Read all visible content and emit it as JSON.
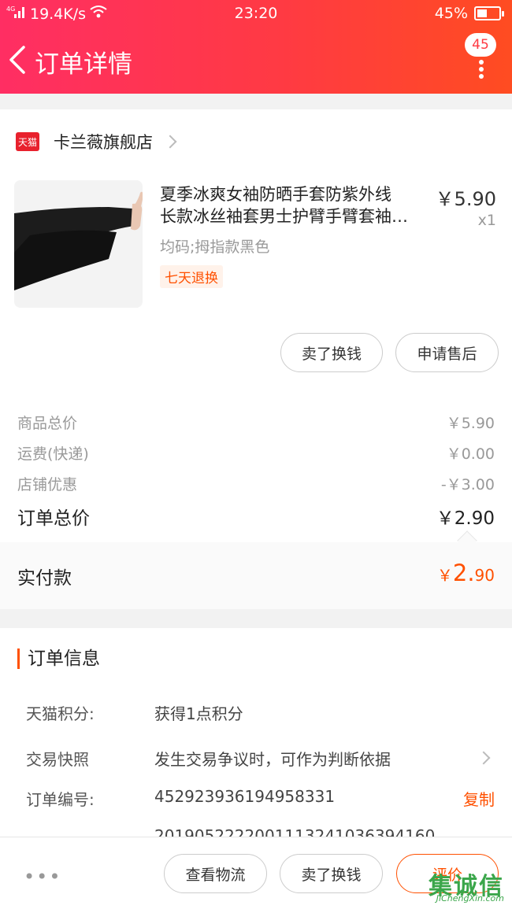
{
  "status_bar": {
    "network": "4G",
    "speed": "19.4K/s",
    "time": "23:20",
    "battery": "45%",
    "battery_level": 0.45
  },
  "header": {
    "title": "订单详情",
    "badge_count": "45",
    "gradient": [
      "#ff2e63",
      "#ff4c21"
    ]
  },
  "store": {
    "logo_text": "天猫",
    "name": "卡兰薇旗舰店"
  },
  "product": {
    "title_line1": "夏季冰爽女袖防晒手套防紫外线",
    "title_line2": "长款冰丝袖套男士护臂手臂套袖…",
    "price": "￥5.90",
    "quantity": "x1",
    "sku": "均码;拇指款黑色",
    "tag": "七天退换",
    "actions": [
      "卖了换钱",
      "申请售后"
    ]
  },
  "summary": {
    "rows": [
      {
        "label": "商品总价",
        "value": "￥5.90"
      },
      {
        "label": "运费(快递)",
        "value": "￥0.00"
      },
      {
        "label": "店铺优惠",
        "value": "-￥3.00"
      }
    ],
    "total_label": "订单总价",
    "total_value": "￥2.90",
    "paid_label": "实付款",
    "paid_currency": "￥",
    "paid_int": "2.",
    "paid_dec": "90"
  },
  "order_info": {
    "title": "订单信息",
    "rows": [
      {
        "label": "天猫积分:",
        "value": "获得1点积分"
      },
      {
        "label": "交易快照",
        "value": "发生交易争议时，可作为判断依据"
      },
      {
        "label": "订单编号:",
        "value": "452923936194958331",
        "action": "复制"
      }
    ],
    "partial_value": "2019052222001113241036394160"
  },
  "bottom_bar": {
    "more": "•••",
    "buttons": [
      "查看物流",
      "卖了换钱",
      "评价"
    ]
  },
  "watermark": {
    "text": "集诚信",
    "url": "JiChengXin.com"
  },
  "colors": {
    "accent": "#ff5000",
    "tmall_red": "#e8212d"
  }
}
